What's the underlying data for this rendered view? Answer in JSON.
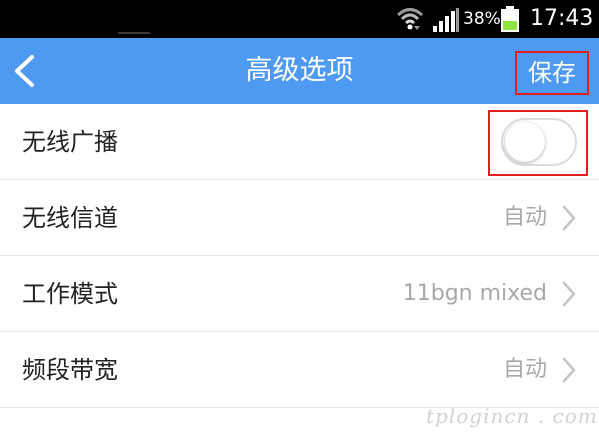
{
  "status_bar": {
    "battery": "38%",
    "time": "17:43",
    "icons": [
      "wifi-icon",
      "signal-icon",
      "battery-icon"
    ],
    "battery_color": "#8ee53f"
  },
  "header": {
    "title": "高级选项",
    "save_label": "保存",
    "background": "#4e9af2",
    "highlight_color": "#e02020"
  },
  "settings": [
    {
      "label": "无线广播",
      "control": "toggle",
      "toggle_on": false
    },
    {
      "label": "无线信道",
      "value": "自动"
    },
    {
      "label": "工作模式",
      "value": "11bgn mixed"
    },
    {
      "label": "频段带宽",
      "value": "自动"
    }
  ],
  "watermark": "tplogincn . com"
}
